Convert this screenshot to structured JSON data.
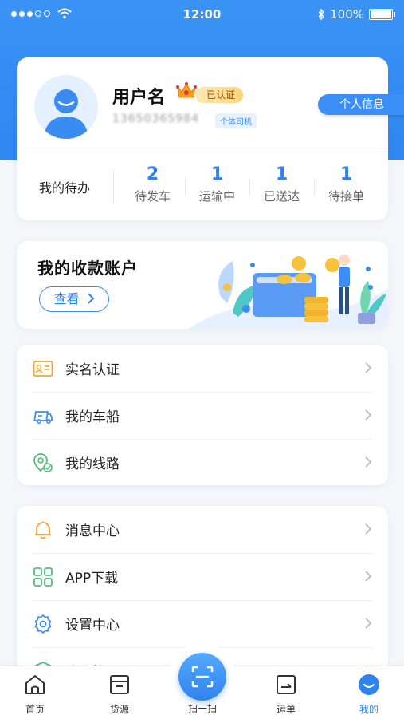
{
  "status_bar": {
    "time": "12:00",
    "battery": "100%"
  },
  "profile": {
    "username": "用户名",
    "verified_badge": "已认证",
    "phone": "13650365984",
    "role_tag": "个体司机",
    "info_button": "个人信息"
  },
  "todo": {
    "label": "我的待办",
    "stats": [
      {
        "value": "2",
        "label": "待发车"
      },
      {
        "value": "1",
        "label": "运输中"
      },
      {
        "value": "1",
        "label": "已送达"
      },
      {
        "value": "1",
        "label": "待接单"
      }
    ]
  },
  "account": {
    "title": "我的收款账户",
    "view_button": "查看"
  },
  "menu_group1": [
    {
      "label": "实名认证",
      "icon": "id-card-icon"
    },
    {
      "label": "我的车船",
      "icon": "truck-icon"
    },
    {
      "label": "我的线路",
      "icon": "route-icon"
    }
  ],
  "menu_group2": [
    {
      "label": "消息中心",
      "icon": "bell-icon"
    },
    {
      "label": "APP下载",
      "icon": "grid-icon"
    },
    {
      "label": "设置中心",
      "icon": "gear-icon"
    },
    {
      "label": "隐私协议",
      "icon": "shield-icon"
    }
  ],
  "tabbar": {
    "home": "首页",
    "goods": "货源",
    "scan": "扫一扫",
    "waybill": "运单",
    "mine": "我的"
  },
  "colors": {
    "primary": "#2f83ee",
    "orange": "#f5a23a",
    "green": "#4cc07a"
  }
}
